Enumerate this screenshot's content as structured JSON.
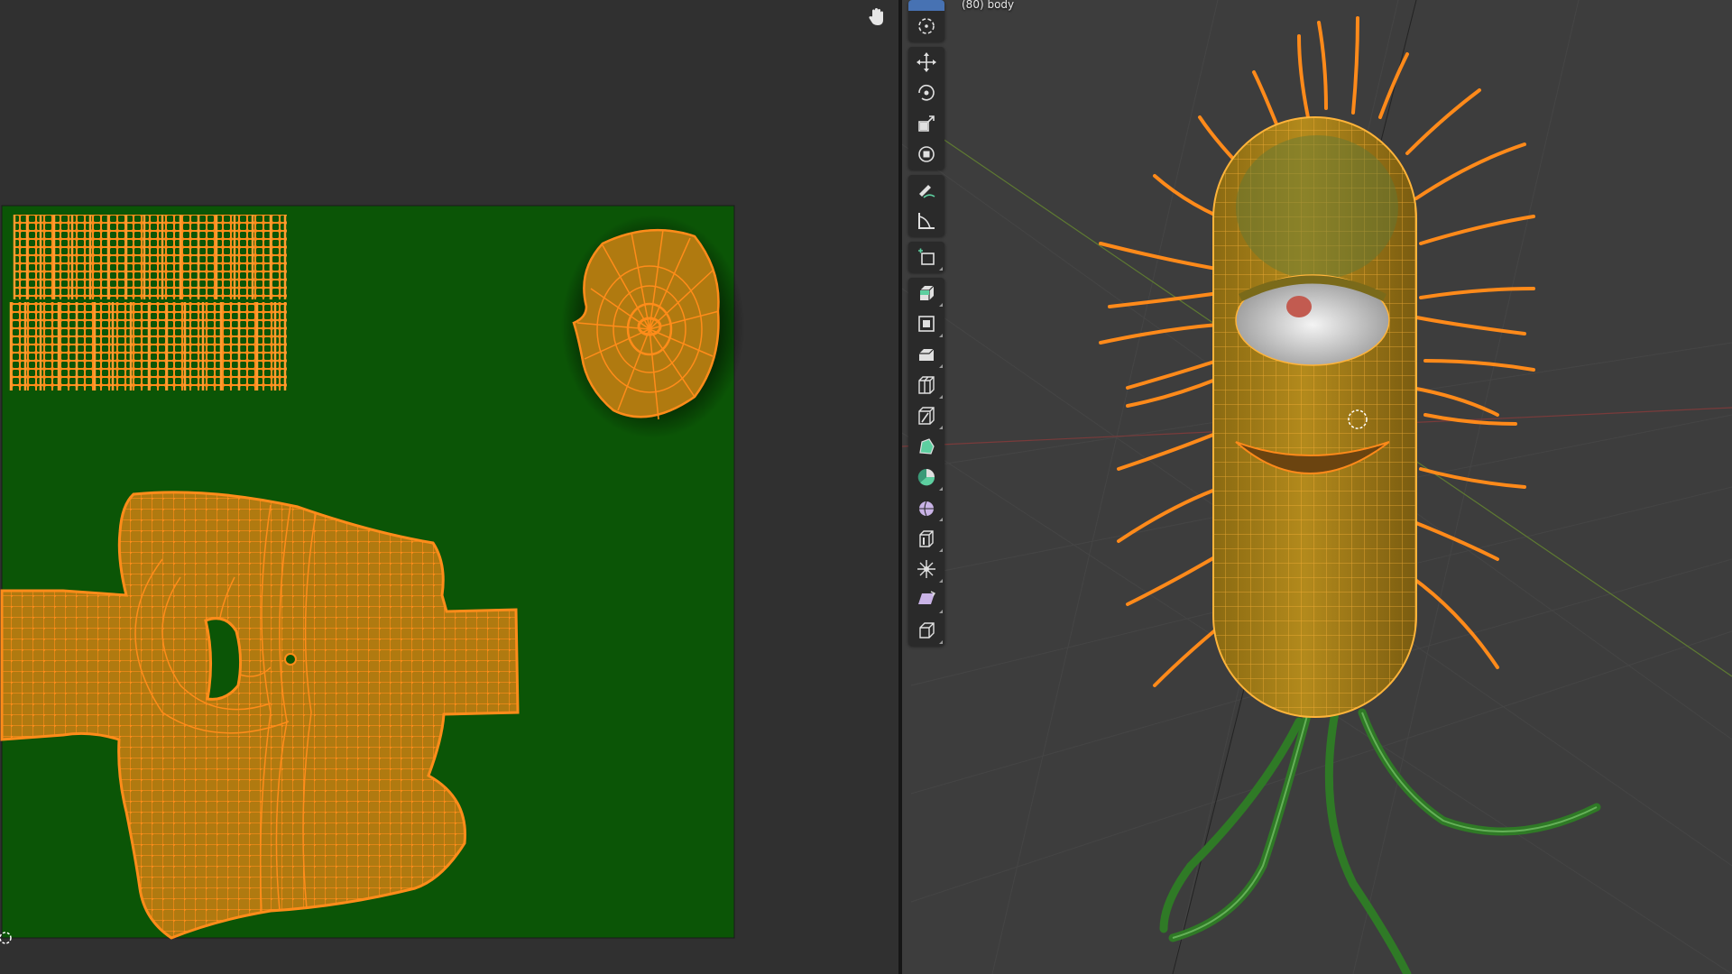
{
  "viewport": {
    "object_info": "(80) body"
  },
  "uv_editor": {
    "background_color": "#303030",
    "texture_color": "#0b5506",
    "island_fill": "#b07a10",
    "island_edge": "#ff8c1a"
  },
  "toolbar": {
    "tools": [
      {
        "name": "select-box-tool",
        "icon": "select-box-icon",
        "active": true
      },
      {
        "name": "cursor-tool",
        "icon": "cursor-icon"
      },
      {
        "name": "move-tool",
        "icon": "move-icon"
      },
      {
        "name": "rotate-tool",
        "icon": "rotate-icon"
      },
      {
        "name": "scale-tool",
        "icon": "scale-icon"
      },
      {
        "name": "transform-tool",
        "icon": "transform-icon"
      },
      {
        "name": "annotate-tool",
        "icon": "annotate-icon"
      },
      {
        "name": "measure-tool",
        "icon": "measure-icon"
      },
      {
        "name": "add-cube-tool",
        "icon": "add-cube-icon"
      },
      {
        "name": "extrude-region-tool",
        "icon": "extrude-icon"
      },
      {
        "name": "inset-faces-tool",
        "icon": "inset-icon"
      },
      {
        "name": "bevel-tool",
        "icon": "bevel-icon"
      },
      {
        "name": "loop-cut-tool",
        "icon": "loop-cut-icon"
      },
      {
        "name": "knife-tool",
        "icon": "knife-icon"
      },
      {
        "name": "poly-build-tool",
        "icon": "poly-build-icon"
      },
      {
        "name": "spin-tool",
        "icon": "spin-icon"
      },
      {
        "name": "smooth-tool",
        "icon": "smooth-icon"
      },
      {
        "name": "edge-slide-tool",
        "icon": "edge-slide-icon"
      },
      {
        "name": "shrink-fatten-tool",
        "icon": "shrink-fatten-icon"
      },
      {
        "name": "shear-tool",
        "icon": "shear-icon"
      },
      {
        "name": "rip-region-tool",
        "icon": "rip-region-icon"
      }
    ]
  }
}
